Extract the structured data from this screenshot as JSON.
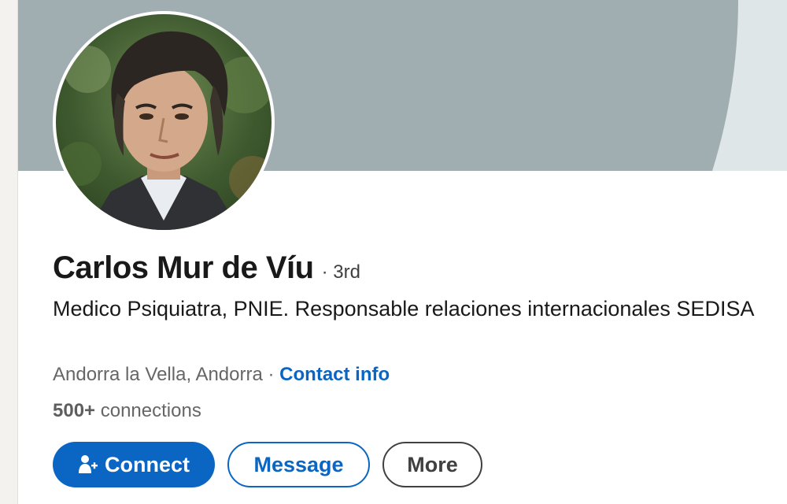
{
  "profile": {
    "name": "Carlos Mur de Víu",
    "degree": "· 3rd",
    "headline": "Medico Psiquiatra, PNIE. Responsable relaciones internacionales SEDISA",
    "location": "Andorra la Vella, Andorra",
    "separator": " · ",
    "contact_info": "Contact info",
    "connections_count": "500+",
    "connections_label": "connections"
  },
  "actions": {
    "connect_label": "Connect",
    "message_label": "Message",
    "more_label": "More"
  },
  "icons": {
    "connect": "add-person-icon"
  },
  "colors": {
    "accent": "#0a66c2",
    "cover_dark": "#a1aeb1",
    "cover_light": "#dfe6e8",
    "muted_text": "#666666"
  }
}
